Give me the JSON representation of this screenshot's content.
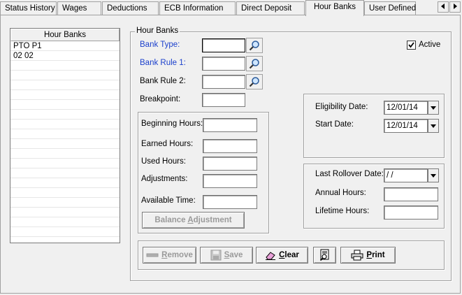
{
  "tabs": [
    {
      "label": "Status History"
    },
    {
      "label": "Wages"
    },
    {
      "label": "Deductions"
    },
    {
      "label": "ECB Information"
    },
    {
      "label": "Direct Deposit"
    },
    {
      "label": "Hour Banks",
      "active": true
    },
    {
      "label": "User Defined"
    }
  ],
  "list": {
    "header": "Hour Banks",
    "rows": [
      "PTO P1",
      "02  02"
    ]
  },
  "group_title": "Hour Banks",
  "active": {
    "label": "Active",
    "checked": true
  },
  "fields": {
    "bank_type": {
      "label": "Bank Type:",
      "value": ""
    },
    "bank_rule1": {
      "label": "Bank Rule 1:",
      "value": ""
    },
    "bank_rule2": {
      "label": "Bank Rule 2:",
      "value": ""
    },
    "breakpoint": {
      "label": "Breakpoint:",
      "value": ""
    },
    "beginning_hours": {
      "label": "Beginning Hours:",
      "value": ""
    },
    "earned_hours": {
      "label": "Earned Hours:",
      "value": ""
    },
    "used_hours": {
      "label": "Used Hours:",
      "value": ""
    },
    "adjustments": {
      "label": "Adjustments:",
      "value": ""
    },
    "available_time": {
      "label": "Available Time:",
      "value": ""
    },
    "eligibility_date": {
      "label": "Eligibility Date:",
      "value": "12/01/14"
    },
    "start_date": {
      "label": "Start Date:",
      "value": "12/01/14"
    },
    "last_rollover_date": {
      "label": "Last Rollover Date:",
      "value": " /  /"
    },
    "annual_hours": {
      "label": "Annual Hours:",
      "value": ""
    },
    "lifetime_hours": {
      "label": "Lifetime Hours:",
      "value": ""
    }
  },
  "buttons": {
    "balance_adjustment_a": "Balance ",
    "balance_adjustment_u": "A",
    "balance_adjustment_b": "djustment",
    "remove_u": "R",
    "remove_rest": "emove",
    "save_u": "S",
    "save_rest": "ave",
    "clear_u": "C",
    "clear_rest": "lear",
    "print_u": "P",
    "print_rest": "rint"
  },
  "icons": {
    "lookup": "magnifier-icon",
    "dropdown": "triangle-down-icon",
    "remove": "minus-icon",
    "save": "floppy-disk-icon",
    "clear": "eraser-icon",
    "preview": "print-preview-icon",
    "print": "printer-icon"
  }
}
